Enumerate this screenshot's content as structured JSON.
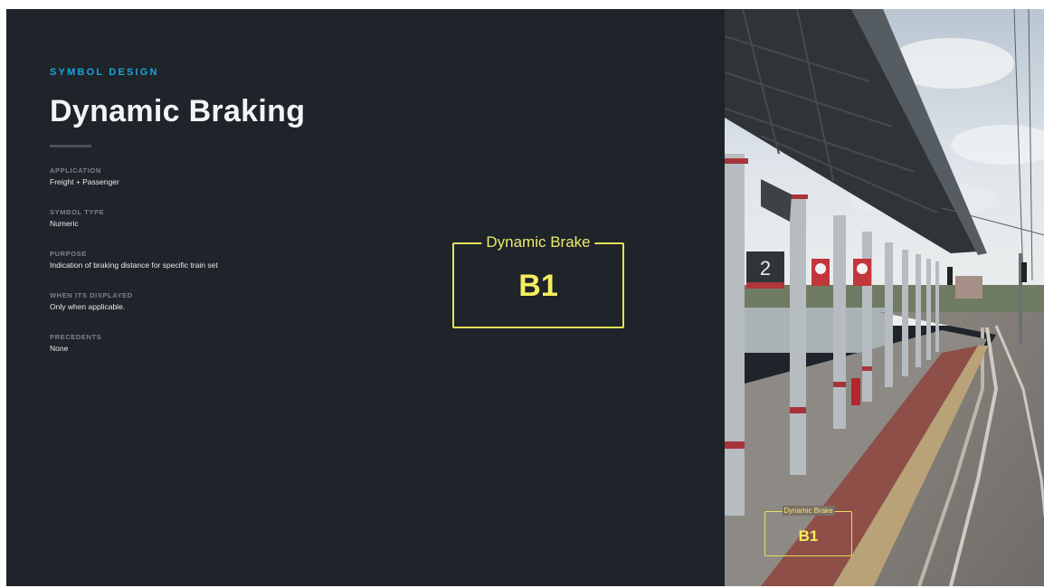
{
  "section_label": "SYMBOL DESIGN",
  "title": "Dynamic Braking",
  "details": [
    {
      "label": "APPLICATION",
      "value": "Freight + Passenger"
    },
    {
      "label": "SYMBOL TYPE",
      "value": "Numeric"
    },
    {
      "label": "PURPOSE",
      "value": "Indication of braking distance for specific train set"
    },
    {
      "label": "WHEN ITS DISPLAYED",
      "value": "Only when applicable."
    },
    {
      "label": "PRECEDENTS",
      "value": "None"
    }
  ],
  "symbol": {
    "caption": "Dynamic Brake",
    "value": "B1"
  },
  "photo": {
    "platform_number": "2"
  },
  "colors": {
    "accent_blue": "#1ba2d8",
    "symbol_yellow": "#e8e05a",
    "background": "#1e242a"
  }
}
